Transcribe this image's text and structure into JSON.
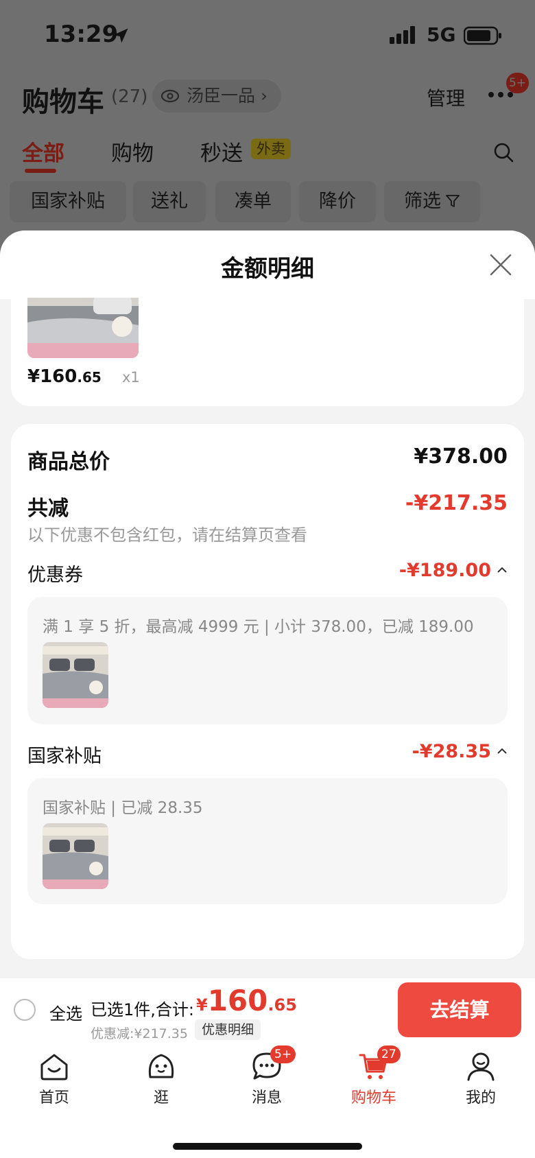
{
  "status_bar": {
    "time": "13:29",
    "network": "5G"
  },
  "header": {
    "title": "购物车",
    "count": "(27)",
    "store_name": "汤臣一品",
    "store_chevron": "›",
    "manage_label": "管理",
    "more_badge": "5+"
  },
  "tabs": [
    {
      "label": "全部",
      "active": true
    },
    {
      "label": "购物"
    },
    {
      "label": "秒送",
      "tag": "外卖"
    }
  ],
  "filters": [
    "国家补贴",
    "送礼",
    "凑单",
    "降价",
    "筛选"
  ],
  "sheet": {
    "title": "金额明细",
    "item": {
      "price_int": "¥160",
      "price_dec": ".65",
      "quantity": "x1"
    },
    "rows": {
      "total_label": "商品总价",
      "total_value": "¥378.00",
      "reduce_label": "共减",
      "reduce_value": "-¥217.35",
      "reduce_note": "以下优惠不包含红包，请在结算页查看",
      "coupon_label": "优惠券",
      "coupon_value": "-¥189.00",
      "coupon_detail": "满 1 享 5 折，最高减 4999 元 | 小计 378.00，已减 189.00",
      "subsidy_label": "国家补贴",
      "subsidy_value": "-¥28.35",
      "subsidy_detail": "国家补贴 | 已减 28.35"
    }
  },
  "action_bar": {
    "select_all": "全选",
    "selected": "已选1件,合计:",
    "total_yen": "¥",
    "total_int": "160",
    "total_dec": ".65",
    "discount": "优惠减:¥217.35",
    "detail_link": "优惠明细",
    "checkout": "去结算"
  },
  "tab_bar": [
    {
      "label": "首页",
      "icon": "home-icon"
    },
    {
      "label": "逛",
      "icon": "explore-icon"
    },
    {
      "label": "消息",
      "icon": "message-icon",
      "badge": "5+"
    },
    {
      "label": "购物车",
      "icon": "cart-icon",
      "badge": "27",
      "active": true
    },
    {
      "label": "我的",
      "icon": "profile-icon"
    }
  ],
  "colors": {
    "accent": "#e23b2e",
    "checkout": "#ef4a3f",
    "overlay": "#6f6f6f"
  }
}
